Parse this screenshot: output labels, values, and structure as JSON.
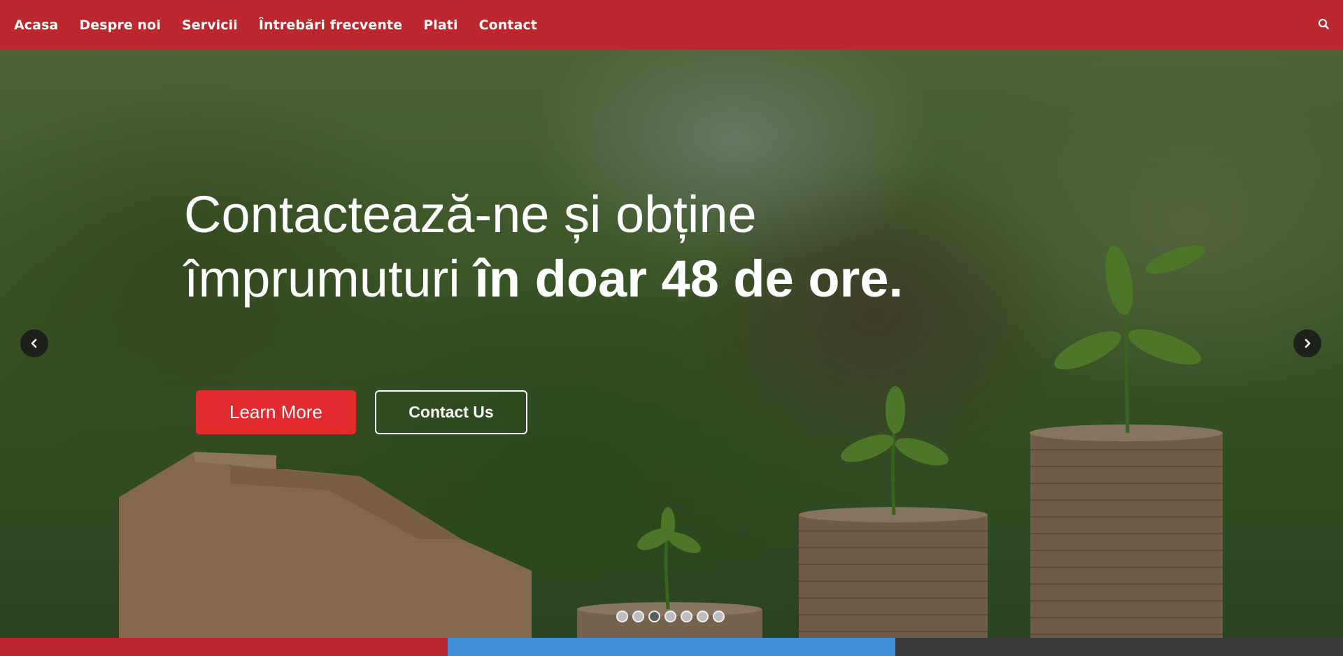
{
  "nav": {
    "items": [
      {
        "label": "Acasa"
      },
      {
        "label": "Despre noi"
      },
      {
        "label": "Servicii"
      },
      {
        "label": "Întrebări frecvente"
      },
      {
        "label": "Plati"
      },
      {
        "label": "Contact"
      }
    ],
    "search_icon": "search-icon"
  },
  "hero": {
    "line1": "Contactează-ne și obține",
    "line2_regular": "împrumuturi ",
    "line2_bold": "în doar 48 de ore.",
    "primary_button": "Learn More",
    "secondary_button": "Contact Us",
    "slide_count": 7,
    "active_slide": 3
  },
  "colors": {
    "nav_bg": "#bc272d",
    "primary_button_bg": "#e22a2f",
    "strip_red": "#b8262c",
    "strip_blue": "#3f8fd6",
    "strip_dark": "#3a3a3a"
  }
}
